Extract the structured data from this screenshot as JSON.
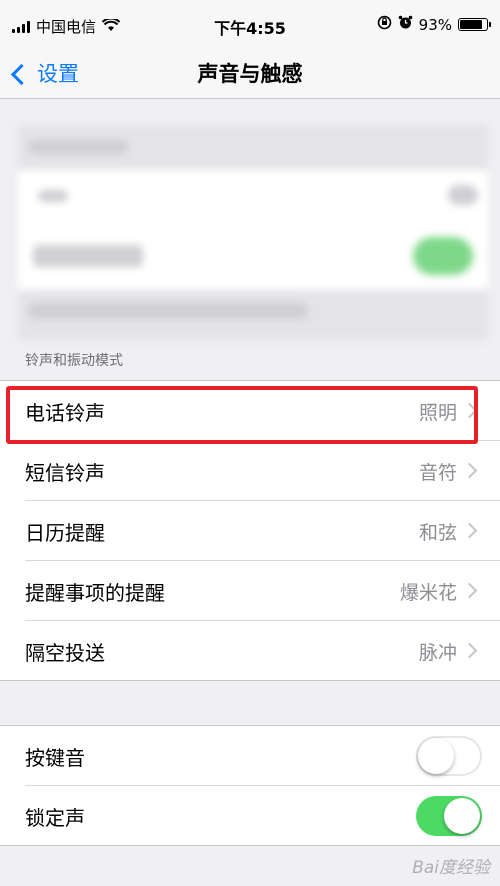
{
  "status_bar": {
    "carrier": "中国电信",
    "time": "下午4:55",
    "battery_percent": "93%",
    "battery_level": 0.93
  },
  "nav": {
    "back_label": "设置",
    "title": "声音与触感"
  },
  "section": {
    "header": "铃声和振动模式",
    "items": [
      {
        "label": "电话铃声",
        "value": "照明"
      },
      {
        "label": "短信铃声",
        "value": "音符"
      },
      {
        "label": "日历提醒",
        "value": "和弦"
      },
      {
        "label": "提醒事项的提醒",
        "value": "爆米花"
      },
      {
        "label": "隔空投送",
        "value": "脉冲"
      }
    ]
  },
  "toggles": {
    "items": [
      {
        "label": "按键音",
        "on": false
      },
      {
        "label": "锁定声",
        "on": true
      }
    ]
  },
  "watermark": "Bai度经验",
  "colors": {
    "accent": "#0a7aff",
    "toggle_on": "#4cd964",
    "highlight": "#e8202a"
  }
}
